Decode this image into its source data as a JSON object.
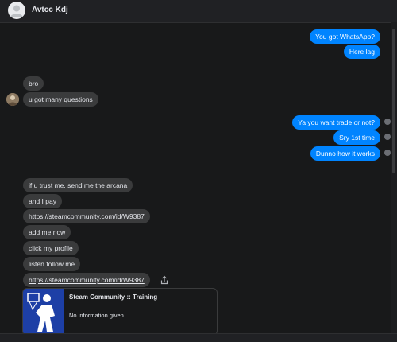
{
  "header": {
    "contact_name": "Avtcc Kdj"
  },
  "messages": [
    {
      "text": "You got WhatsApp?",
      "from": "me"
    },
    {
      "text": "Here lag",
      "from": "me"
    },
    {
      "text": "bro",
      "from": "them"
    },
    {
      "text": "u got many questions",
      "from": "them"
    },
    {
      "text": "Ya you want trade or not?",
      "from": "me"
    },
    {
      "text": "Sry 1st time",
      "from": "me"
    },
    {
      "text": "Dunno how it works",
      "from": "me"
    },
    {
      "text": "if u trust me, send me the arcana",
      "from": "them"
    },
    {
      "text": "and I pay",
      "from": "them"
    },
    {
      "text": "https://steamcommunity.com/id/W9387",
      "from": "them"
    },
    {
      "text": "add me now",
      "from": "them"
    },
    {
      "text": "click my profile",
      "from": "them"
    },
    {
      "text": "listen follow me",
      "from": "them"
    },
    {
      "text": "https://steamcommunity.com/id/W9387",
      "from": "them"
    }
  ],
  "link_preview": {
    "title": "Steam Community :: Training",
    "description": "No information given."
  },
  "colors": {
    "outgoing": "#0084ff",
    "incoming": "#3a3b3c",
    "background": "#18191a"
  },
  "icons": [
    "user-avatar-icon",
    "seen-indicator-icon",
    "share-icon"
  ]
}
